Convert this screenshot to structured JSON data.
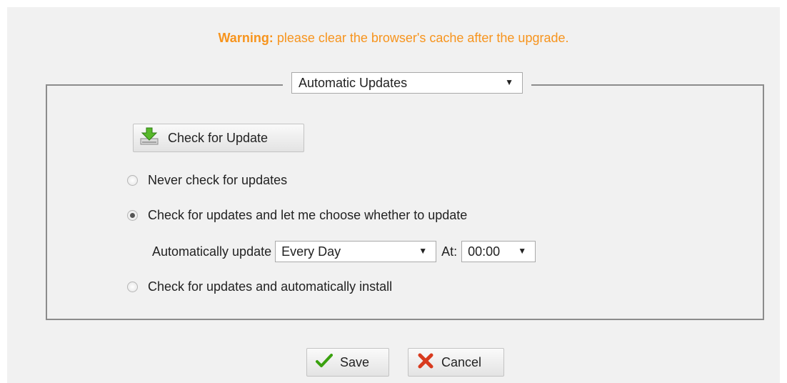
{
  "warning": {
    "prefix": "Warning:",
    "text": " please clear the browser's cache after the upgrade."
  },
  "section": {
    "selected": "Automatic Updates"
  },
  "check_button": {
    "label": "Check for Update",
    "icon": "download-arrow-icon"
  },
  "options": [
    {
      "label": "Never check for updates",
      "checked": false
    },
    {
      "label": "Check for updates and let me choose whether to update",
      "checked": true
    },
    {
      "label": "Check for updates and automatically install",
      "checked": false
    }
  ],
  "schedule": {
    "label": "Automatically update",
    "frequency": "Every Day",
    "at_label": "At:",
    "time": "00:00"
  },
  "actions": {
    "save": "Save",
    "cancel": "Cancel"
  },
  "colors": {
    "warning": "#f7941d",
    "background": "#f1f1f1"
  }
}
